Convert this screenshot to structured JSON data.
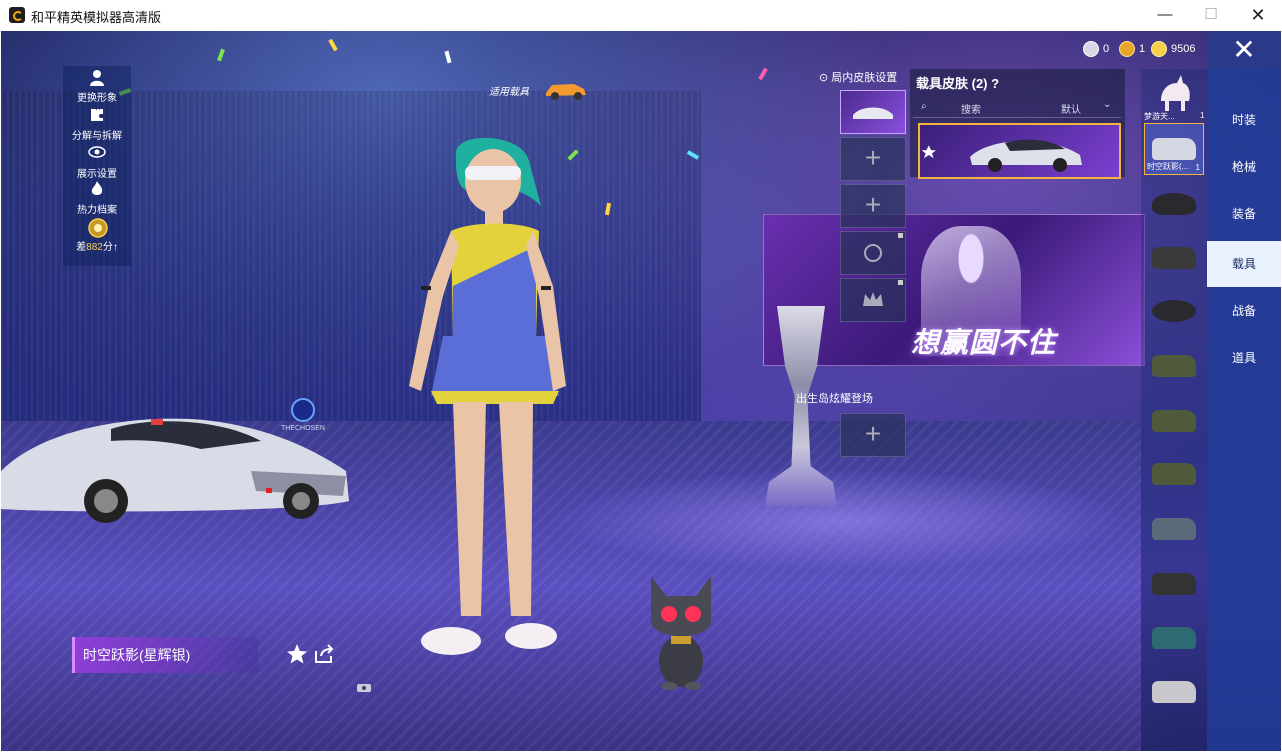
{
  "window": {
    "title": "和平精英模拟器高清版",
    "minimize": "—",
    "maximize": "☐",
    "close": "✕"
  },
  "currency": {
    "coupon": "0",
    "token": "1",
    "coins": "9506"
  },
  "left_menu": [
    {
      "label": "更换形象",
      "icon": "person-icon"
    },
    {
      "label": "分解与拆解",
      "icon": "puzzle-icon"
    },
    {
      "label": "展示设置",
      "icon": "eye-icon"
    },
    {
      "label": "热力档案",
      "icon": "flame-icon"
    }
  ],
  "score": {
    "prefix": "差",
    "value": "882",
    "suffix": "分"
  },
  "apply_vehicle": "适用载具",
  "ingame_skin_label": "局内皮肤设置",
  "island_label": "出生岛炫耀登场",
  "skin_panel": {
    "title": "载具皮肤 (2)",
    "search": "搜索",
    "sort": "默认"
  },
  "banner_text": "想赢圆不住",
  "chosen_logo": "THECHOSEN",
  "vehicle_name": "时空跃影(星辉银)",
  "vehicle_list": {
    "dream_label": "梦游天...",
    "dream_count": "1",
    "selected_label": "时空跃影(...",
    "selected_count": "1"
  },
  "tabs": [
    "时装",
    "枪械",
    "装备",
    "载具",
    "战备",
    "道具"
  ],
  "active_tab": "载具",
  "colors": {
    "accent": "#f3b33d",
    "tab_active": "#eaf1ff",
    "panel": "#1e3c96"
  }
}
